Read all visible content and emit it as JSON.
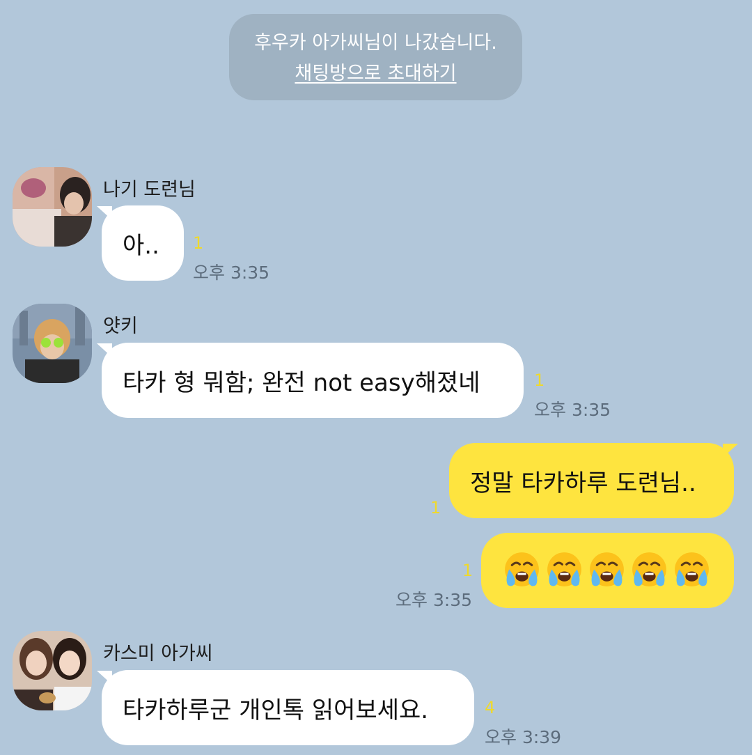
{
  "system_notice": {
    "text": "후우카 아가씨님이 나갔습니다.",
    "invite_link": "채팅방으로 초대하기"
  },
  "messages": [
    {
      "sender": "나기 도련님",
      "text": "아..",
      "unread": "1",
      "time": "오후 3:35",
      "avatar_icon": "profile-photo"
    },
    {
      "sender": "얏키",
      "text": "타카 형 뭐함; 완전 not easy해졌네",
      "unread": "1",
      "time": "오후 3:35",
      "avatar_icon": "profile-photo"
    },
    {
      "text": "정말 타카하루 도련님..",
      "unread": "1"
    },
    {
      "emoji_icon": "loudly-crying-face-emoji",
      "emoji_count": 5,
      "unread": "1",
      "time": "오후 3:35"
    },
    {
      "sender": "카스미 아가씨",
      "text": "타카하루군 개인톡 읽어보세요.",
      "unread": "4",
      "time": "오후 3:39",
      "avatar_icon": "profile-photo"
    }
  ],
  "colors": {
    "background": "#b2c7da",
    "incoming_bubble": "#ffffff",
    "outgoing_bubble": "#fee43f",
    "unread_count": "#efd92c",
    "timestamp": "#5c6c7c"
  }
}
